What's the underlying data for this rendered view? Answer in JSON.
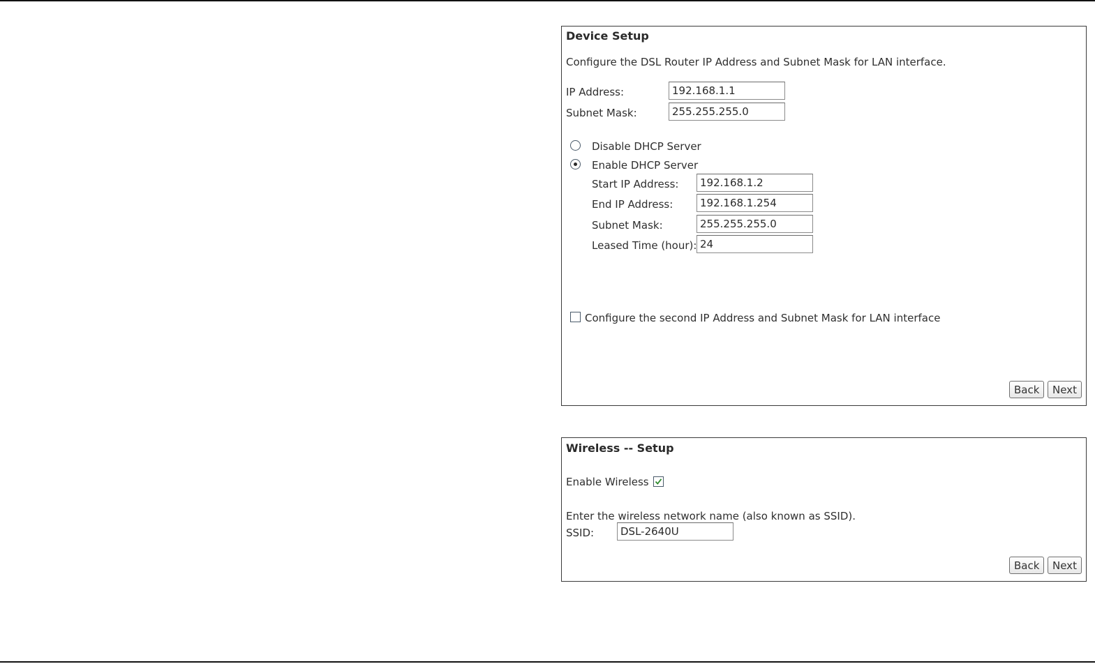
{
  "device_setup": {
    "title": "Device Setup",
    "description": "Configure the DSL Router IP Address and Subnet Mask for LAN interface.",
    "ip_address_label": "IP Address:",
    "ip_address_value": "192.168.1.1",
    "subnet_mask_label": "Subnet Mask:",
    "subnet_mask_value": "255.255.255.0",
    "dhcp": {
      "disable_label": "Disable DHCP Server",
      "enable_label": "Enable DHCP Server",
      "selected": "enable",
      "start_ip_label": "Start IP Address:",
      "start_ip_value": "192.168.1.2",
      "end_ip_label": "End IP Address:",
      "end_ip_value": "192.168.1.254",
      "subnet_mask_label": "Subnet Mask:",
      "subnet_mask_value": "255.255.255.0",
      "lease_time_label": "Leased Time (hour):",
      "lease_time_value": "24"
    },
    "second_ip_label": "Configure the second IP Address and Subnet Mask for LAN interface",
    "second_ip_checked": false,
    "back_label": "Back",
    "next_label": "Next"
  },
  "wireless_setup": {
    "title": "Wireless -- Setup",
    "enable_label": "Enable Wireless",
    "enable_checked": true,
    "ssid_prompt": "Enter the wireless network name (also known as SSID).",
    "ssid_label": "SSID:",
    "ssid_value": "DSL-2640U",
    "back_label": "Back",
    "next_label": "Next"
  },
  "colors": {
    "checkmark": "#2e8b2e",
    "border": "#3a3a3a"
  }
}
